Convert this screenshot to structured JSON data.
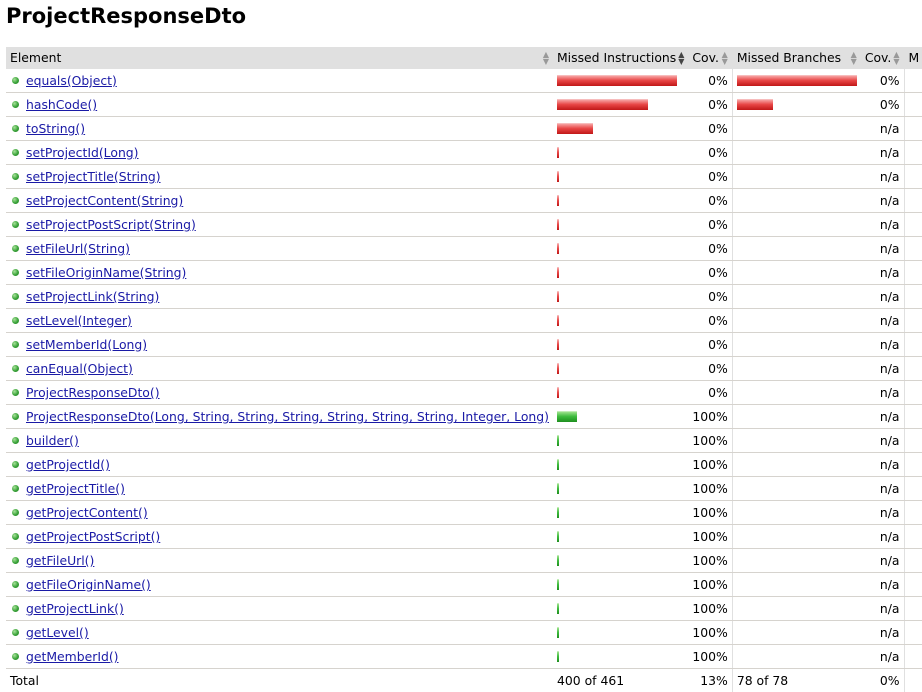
{
  "title": "ProjectResponseDto",
  "colors": {
    "missed_bar": "#e84545",
    "covered_bar": "#3dbb3d",
    "header_bg": "#e0e0e0",
    "link": "#1a1aa6"
  },
  "headers": {
    "element": "Element",
    "missed_instructions": "Missed Instructions",
    "cov": "Cov.",
    "missed_branches": "Missed Branches",
    "cov2": "Cov.",
    "more": "M"
  },
  "rows": [
    {
      "name": "equals(Object)",
      "instr_missed_frac": 1.0,
      "instr_covered_frac": 0,
      "instr_cov": "0%",
      "branch_missed_frac": 1.0,
      "branch_cov": "0%"
    },
    {
      "name": "hashCode()",
      "instr_missed_frac": 0.76,
      "instr_covered_frac": 0,
      "instr_cov": "0%",
      "branch_missed_frac": 0.3,
      "branch_cov": "0%"
    },
    {
      "name": "toString()",
      "instr_missed_frac": 0.3,
      "instr_covered_frac": 0,
      "instr_cov": "0%",
      "branch_missed_frac": 0,
      "branch_cov": "n/a"
    },
    {
      "name": "setProjectId(Long)",
      "instr_missed_frac": 0.01,
      "instr_covered_frac": 0,
      "instr_cov": "0%",
      "branch_missed_frac": 0,
      "branch_cov": "n/a"
    },
    {
      "name": "setProjectTitle(String)",
      "instr_missed_frac": 0.01,
      "instr_covered_frac": 0,
      "instr_cov": "0%",
      "branch_missed_frac": 0,
      "branch_cov": "n/a"
    },
    {
      "name": "setProjectContent(String)",
      "instr_missed_frac": 0.01,
      "instr_covered_frac": 0,
      "instr_cov": "0%",
      "branch_missed_frac": 0,
      "branch_cov": "n/a"
    },
    {
      "name": "setProjectPostScript(String)",
      "instr_missed_frac": 0.01,
      "instr_covered_frac": 0,
      "instr_cov": "0%",
      "branch_missed_frac": 0,
      "branch_cov": "n/a"
    },
    {
      "name": "setFileUrl(String)",
      "instr_missed_frac": 0.01,
      "instr_covered_frac": 0,
      "instr_cov": "0%",
      "branch_missed_frac": 0,
      "branch_cov": "n/a"
    },
    {
      "name": "setFileOriginName(String)",
      "instr_missed_frac": 0.01,
      "instr_covered_frac": 0,
      "instr_cov": "0%",
      "branch_missed_frac": 0,
      "branch_cov": "n/a"
    },
    {
      "name": "setProjectLink(String)",
      "instr_missed_frac": 0.01,
      "instr_covered_frac": 0,
      "instr_cov": "0%",
      "branch_missed_frac": 0,
      "branch_cov": "n/a"
    },
    {
      "name": "setLevel(Integer)",
      "instr_missed_frac": 0.01,
      "instr_covered_frac": 0,
      "instr_cov": "0%",
      "branch_missed_frac": 0,
      "branch_cov": "n/a"
    },
    {
      "name": "setMemberId(Long)",
      "instr_missed_frac": 0.01,
      "instr_covered_frac": 0,
      "instr_cov": "0%",
      "branch_missed_frac": 0,
      "branch_cov": "n/a"
    },
    {
      "name": "canEqual(Object)",
      "instr_missed_frac": 0.01,
      "instr_covered_frac": 0,
      "instr_cov": "0%",
      "branch_missed_frac": 0,
      "branch_cov": "n/a"
    },
    {
      "name": "ProjectResponseDto()",
      "instr_missed_frac": 0.01,
      "instr_covered_frac": 0,
      "instr_cov": "0%",
      "branch_missed_frac": 0,
      "branch_cov": "n/a"
    },
    {
      "name": "ProjectResponseDto(Long, String, String, String, String, String, String, Integer, Long)",
      "instr_missed_frac": 0,
      "instr_covered_frac": 0.17,
      "instr_cov": "100%",
      "branch_missed_frac": 0,
      "branch_cov": "n/a"
    },
    {
      "name": "builder()",
      "instr_missed_frac": 0,
      "instr_covered_frac": 0.01,
      "instr_cov": "100%",
      "branch_missed_frac": 0,
      "branch_cov": "n/a"
    },
    {
      "name": "getProjectId()",
      "instr_missed_frac": 0,
      "instr_covered_frac": 0.01,
      "instr_cov": "100%",
      "branch_missed_frac": 0,
      "branch_cov": "n/a"
    },
    {
      "name": "getProjectTitle()",
      "instr_missed_frac": 0,
      "instr_covered_frac": 0.01,
      "instr_cov": "100%",
      "branch_missed_frac": 0,
      "branch_cov": "n/a"
    },
    {
      "name": "getProjectContent()",
      "instr_missed_frac": 0,
      "instr_covered_frac": 0.01,
      "instr_cov": "100%",
      "branch_missed_frac": 0,
      "branch_cov": "n/a"
    },
    {
      "name": "getProjectPostScript()",
      "instr_missed_frac": 0,
      "instr_covered_frac": 0.01,
      "instr_cov": "100%",
      "branch_missed_frac": 0,
      "branch_cov": "n/a"
    },
    {
      "name": "getFileUrl()",
      "instr_missed_frac": 0,
      "instr_covered_frac": 0.01,
      "instr_cov": "100%",
      "branch_missed_frac": 0,
      "branch_cov": "n/a"
    },
    {
      "name": "getFileOriginName()",
      "instr_missed_frac": 0,
      "instr_covered_frac": 0.01,
      "instr_cov": "100%",
      "branch_missed_frac": 0,
      "branch_cov": "n/a"
    },
    {
      "name": "getProjectLink()",
      "instr_missed_frac": 0,
      "instr_covered_frac": 0.01,
      "instr_cov": "100%",
      "branch_missed_frac": 0,
      "branch_cov": "n/a"
    },
    {
      "name": "getLevel()",
      "instr_missed_frac": 0,
      "instr_covered_frac": 0.01,
      "instr_cov": "100%",
      "branch_missed_frac": 0,
      "branch_cov": "n/a"
    },
    {
      "name": "getMemberId()",
      "instr_missed_frac": 0,
      "instr_covered_frac": 0.01,
      "instr_cov": "100%",
      "branch_missed_frac": 0,
      "branch_cov": "n/a"
    }
  ],
  "totals": {
    "label": "Total",
    "missed_instructions": "400 of 461",
    "instr_cov": "13%",
    "missed_branches": "78 of 78",
    "branch_cov": "0%"
  }
}
